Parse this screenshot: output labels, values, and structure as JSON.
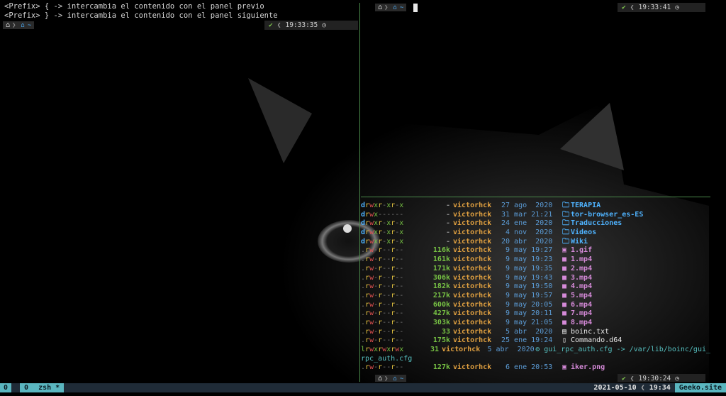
{
  "left_pane": {
    "lines": [
      "<Prefix> { -> intercambia el contenido con el panel previo",
      "<Prefix> } -> intercambia el contenido con el panel siguiente"
    ],
    "prompt": {
      "apple_icon": "apple-icon",
      "home_icon": "home-icon",
      "dir": "~"
    },
    "rprompt": {
      "check": "✔",
      "time": "19:33:35",
      "clock_icon": "clock-icon"
    }
  },
  "top_right_pane": {
    "prompt": {
      "dir": "~"
    },
    "rprompt": {
      "check": "✔",
      "time": "19:33:41"
    }
  },
  "bottom_right_pane": {
    "listing": [
      {
        "perm": "drwxr-xr-x",
        "size": "-",
        "user": "victorhck",
        "date": "27 ago  2020",
        "name": "TERAPIA",
        "kind": "dir",
        "icon": "folder-icon"
      },
      {
        "perm": "drwx------",
        "size": "-",
        "user": "victorhck",
        "date": "31 mar 21:21",
        "name": "tor-browser_es-ES",
        "kind": "dir",
        "icon": "folder-icon"
      },
      {
        "perm": "drwxr-xr-x",
        "size": "-",
        "user": "victorhck",
        "date": "24 ene  2020",
        "name": "Traducciones",
        "kind": "dir",
        "icon": "folder-icon"
      },
      {
        "perm": "drwxr-xr-x",
        "size": "-",
        "user": "victorhck",
        "date": " 4 nov  2020",
        "name": "Videos",
        "kind": "dir",
        "icon": "folder-icon"
      },
      {
        "perm": "drwxr-xr-x",
        "size": "-",
        "user": "victorhck",
        "date": "20 abr  2020",
        "name": "Wiki",
        "kind": "dir",
        "icon": "folder-icon"
      },
      {
        "perm": ".rw-r--r--",
        "size": "116k",
        "user": "victorhck",
        "date": " 9 may 19:27",
        "name": "1.gif",
        "kind": "media",
        "icon": "image-icon"
      },
      {
        "perm": ".rw-r--r--",
        "size": "161k",
        "user": "victorhck",
        "date": " 9 may 19:23",
        "name": "1.mp4",
        "kind": "media",
        "icon": "video-icon"
      },
      {
        "perm": ".rw-r--r--",
        "size": "171k",
        "user": "victorhck",
        "date": " 9 may 19:35",
        "name": "2.mp4",
        "kind": "media",
        "icon": "video-icon"
      },
      {
        "perm": ".rw-r--r--",
        "size": "306k",
        "user": "victorhck",
        "date": " 9 may 19:43",
        "name": "3.mp4",
        "kind": "media",
        "icon": "video-icon"
      },
      {
        "perm": ".rw-r--r--",
        "size": "182k",
        "user": "victorhck",
        "date": " 9 may 19:50",
        "name": "4.mp4",
        "kind": "media",
        "icon": "video-icon"
      },
      {
        "perm": ".rw-r--r--",
        "size": "217k",
        "user": "victorhck",
        "date": " 9 may 19:57",
        "name": "5.mp4",
        "kind": "media",
        "icon": "video-icon"
      },
      {
        "perm": ".rw-r--r--",
        "size": "600k",
        "user": "victorhck",
        "date": " 9 may 20:05",
        "name": "6.mp4",
        "kind": "media",
        "icon": "video-icon"
      },
      {
        "perm": ".rw-r--r--",
        "size": "427k",
        "user": "victorhck",
        "date": " 9 may 20:11",
        "name": "7.mp4",
        "kind": "media",
        "icon": "video-icon"
      },
      {
        "perm": ".rw-r--r--",
        "size": "303k",
        "user": "victorhck",
        "date": " 9 may 21:05",
        "name": "8.mp4",
        "kind": "media",
        "icon": "video-icon"
      },
      {
        "perm": ".rw-r--r--",
        "size": "33",
        "user": "victorhck",
        "date": " 5 abr  2020",
        "name": "boinc.txt",
        "kind": "file",
        "icon": "text-file-icon"
      },
      {
        "perm": ".rw-r--r--",
        "size": "175k",
        "user": "victorhck",
        "date": "25 ene 19:24",
        "name": "Commando.d64",
        "kind": "file",
        "icon": "file-icon"
      },
      {
        "perm": "lrwxrwxrwx",
        "size": "31",
        "user": "victorhck",
        "date": " 5 abr  2020",
        "name": "gui_rpc_auth.cfg -> /var/lib/boinc/gui_",
        "kind": "link",
        "icon": "gear-icon"
      },
      {
        "wrap": "rpc_auth.cfg"
      },
      {
        "perm": ".rw-r--r--",
        "size": "127k",
        "user": "victorhck",
        "date": " 6 ene 20:53",
        "name": "iker.png",
        "kind": "media",
        "icon": "image-icon"
      }
    ],
    "rprompt": {
      "check": "✔",
      "time": "19:30:24"
    },
    "prompt": {
      "dir": "~"
    }
  },
  "status_bar": {
    "session": "0",
    "window_index": "0",
    "window_name": "zsh *",
    "date": "2021-05-10",
    "time": "19:34",
    "host": "Geeko.site"
  },
  "colors": {
    "pane_divider": "#4a8a4a",
    "status_bg": "#1f2b37",
    "status_accent": "#5ab6c0"
  }
}
